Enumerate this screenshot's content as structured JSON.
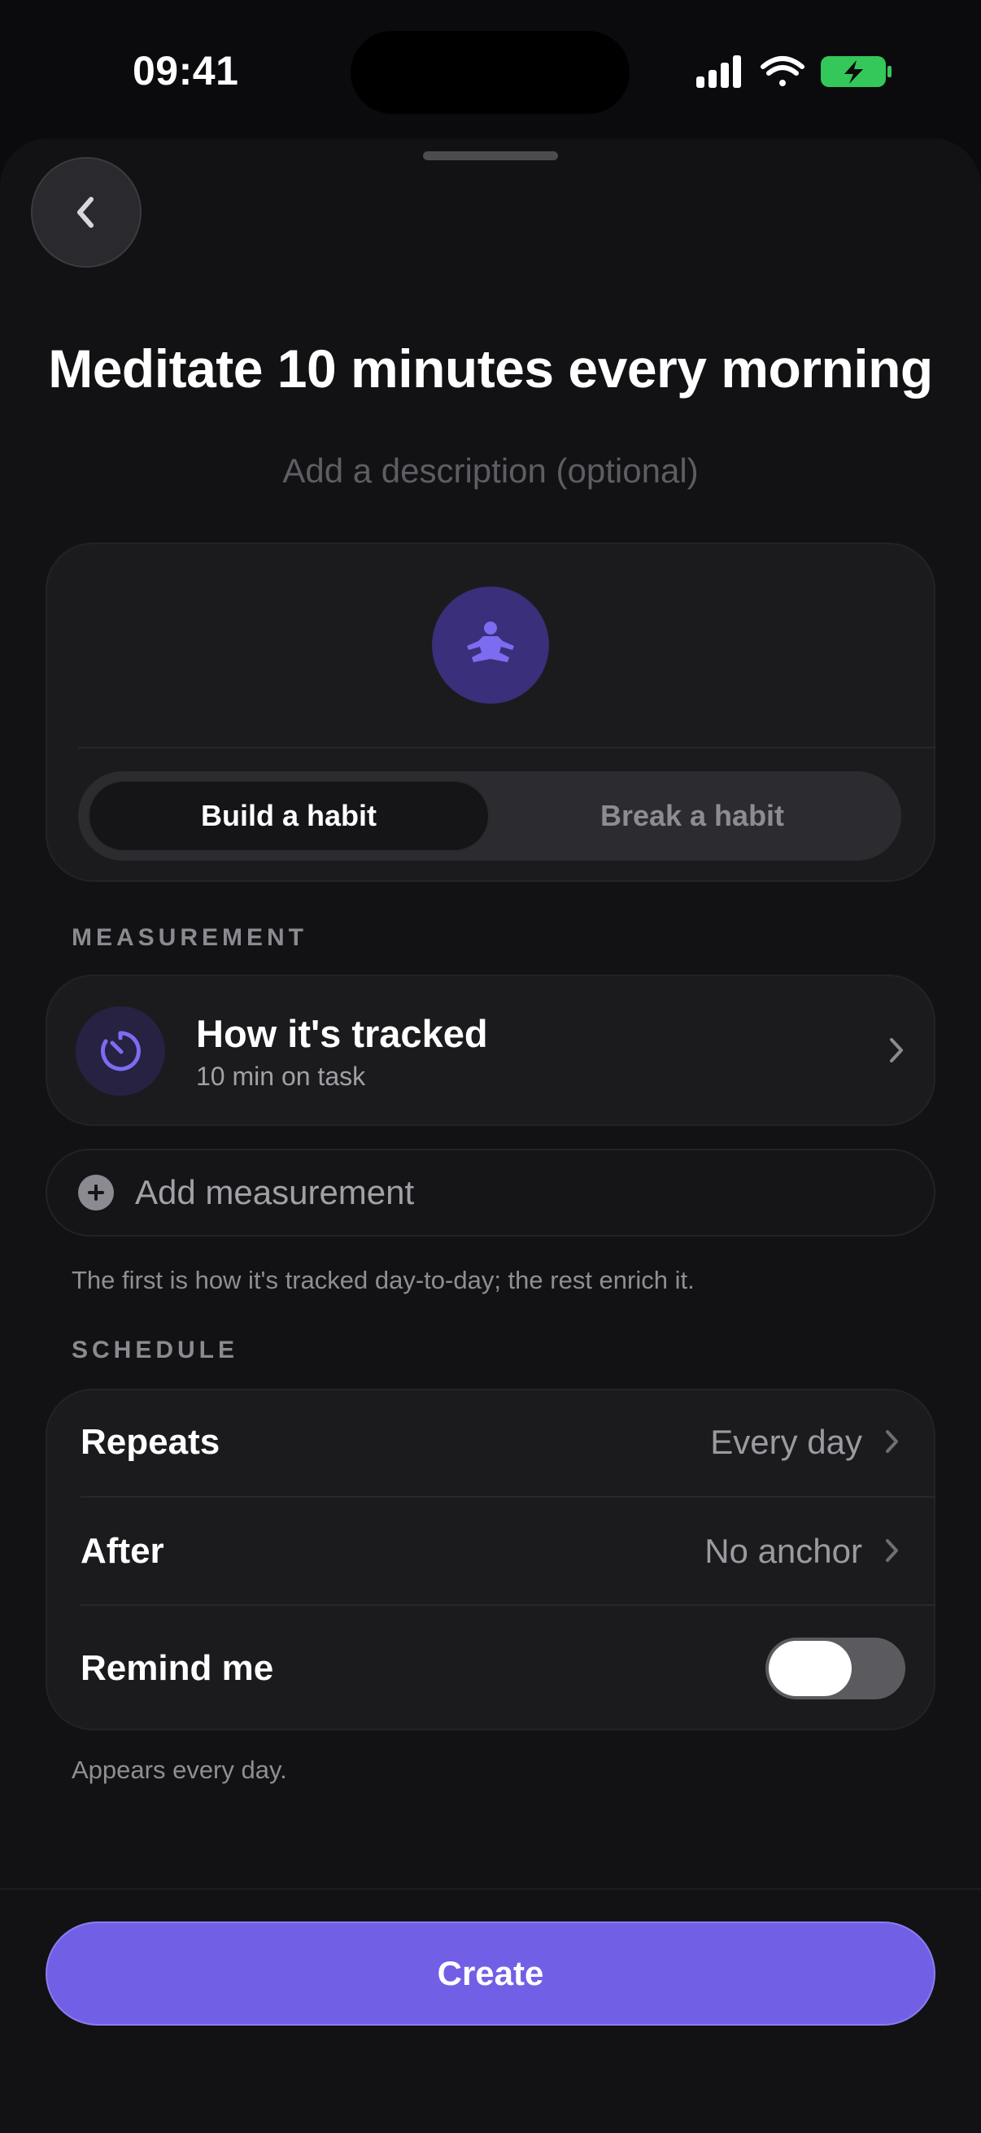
{
  "status_bar": {
    "time": "09:41"
  },
  "header": {
    "back_icon": "chevron-left-icon",
    "title": "Meditate 10 minutes every morning",
    "description_placeholder": "Add a description (optional)"
  },
  "habit": {
    "icon": "meditation-icon",
    "segments": [
      "Build a habit",
      "Break a habit"
    ],
    "selected_segment": "Build a habit"
  },
  "measurement": {
    "section_label": "MEASUREMENT",
    "tracked": {
      "icon": "timer-icon",
      "title": "How it's tracked",
      "subtitle": "10 min on task"
    },
    "add_label": "Add measurement",
    "hint": "The first is how it's tracked day-to-day; the rest enrich it."
  },
  "schedule": {
    "section_label": "SCHEDULE",
    "rows": [
      {
        "label": "Repeats",
        "value": "Every day"
      },
      {
        "label": "After",
        "value": "No anchor"
      },
      {
        "label": "Remind me",
        "toggle_on": false
      }
    ],
    "hint": "Appears every day."
  },
  "footer": {
    "create_label": "Create"
  },
  "colors": {
    "accent": "#7160e6",
    "background": "#0b0b0d",
    "card": "#1b1b1e",
    "battery": "#34c759"
  }
}
